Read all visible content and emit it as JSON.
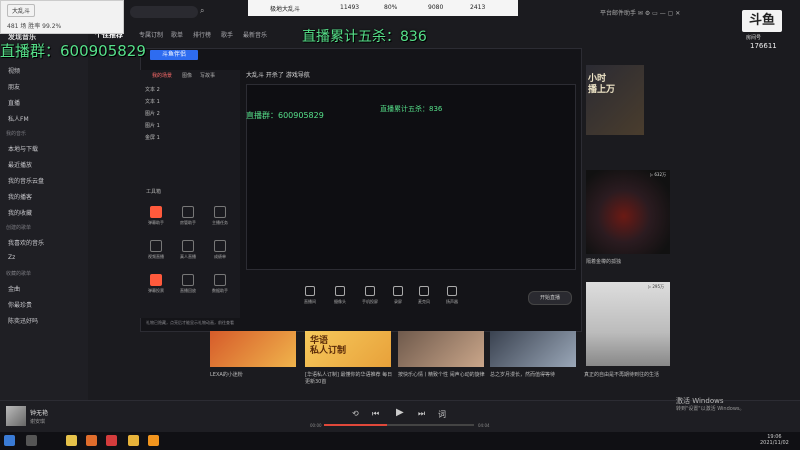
{
  "popup": {
    "title": "大乱斗",
    "subtitle": "481 场   胜率 99.2%"
  },
  "stats": {
    "name": "极地大乱斗",
    "v1": "11493",
    "v2": "80%",
    "v3": "9080",
    "v4": "2413"
  },
  "overlay": {
    "group": "直播群：600905829",
    "kills": "直播累计五杀：836"
  },
  "logo": {
    "text": "斗鱼",
    "sub": "房间号",
    "room": "176611"
  },
  "window_controls": "平台邮件助手 ✉ ⚙ ▭ — ▢ ✕",
  "sidebar": {
    "brand": "发现音乐",
    "items": [
      "视频",
      "朋友",
      "直播",
      "私人FM",
      "本地与下载",
      "最近播放",
      "我的音乐云盘",
      "我的播客",
      "我的收藏",
      "我喜欢的音乐",
      "Zz",
      "金曲",
      "你最珍贵",
      "陈奕迅好吗"
    ],
    "sections": [
      "我的音乐",
      "创建的歌单",
      "收藏的歌单"
    ]
  },
  "nav": {
    "tabs": [
      "个性推荐",
      "专属订制",
      "歌单",
      "排行榜",
      "歌手",
      "最新音乐"
    ]
  },
  "obs": {
    "brand": "斗鱼伴侣",
    "tabs": [
      "我的场景",
      "图像",
      "写故事"
    ],
    "layers": [
      "文本 2",
      "文本 1",
      "图片 2",
      "图片 1",
      "金屏 1"
    ],
    "toolbox": "工具箱",
    "tools": [
      "弹幕助手",
      "房管助手",
      "主播任务",
      "视频直播",
      "真人直播",
      "成绩单",
      "弹幕投票",
      "直播回放",
      "数据助手"
    ],
    "head": "大乱斗 开杀了    游戏导航",
    "inner_group": "直播群：600905829",
    "inner_kills": "直播累计五杀：836",
    "bottom": [
      "直播间",
      "摄像头",
      "手机投屏",
      "录屏",
      "麦克风",
      "扬声器"
    ],
    "go_live": "开始直播",
    "notice": "礼物已隐藏，点亮后才能显示礼物动画，前往查看"
  },
  "right": {
    "banner": "小时\n播上万",
    "wine_count": "▷ 632万",
    "wine_caption": "隔着金樽的孤独",
    "anime_count": "▷ 295万",
    "anime_caption": "真正的自由是不再期待到往的生活"
  },
  "cards": [
    {
      "caption": "LEXA的小迷粉"
    },
    {
      "overlay": "华语\n私人订制",
      "caption": "[华语私人订制] 最懂你的华语推荐 每日更新30首"
    },
    {
      "caption": "按快乐心情丨精致个性 闹声心动的旋律"
    },
    {
      "caption": "总之岁月漫长，然而值得等待"
    }
  ],
  "player": {
    "song": "钟无艳",
    "artist": "谢安琪",
    "time_left": "00:00",
    "time_right": "04:04",
    "progress": 0.42
  },
  "activation": {
    "line1": "激活 Windows",
    "line2": "转到\"设置\"以激活 Windows。"
  },
  "clock": {
    "time": "19:06",
    "date": "2021/11/02"
  },
  "colors": {
    "overlay_green": "#56e08a",
    "accent_red": "#e0483a",
    "obs_blue": "#2e6cf0"
  }
}
